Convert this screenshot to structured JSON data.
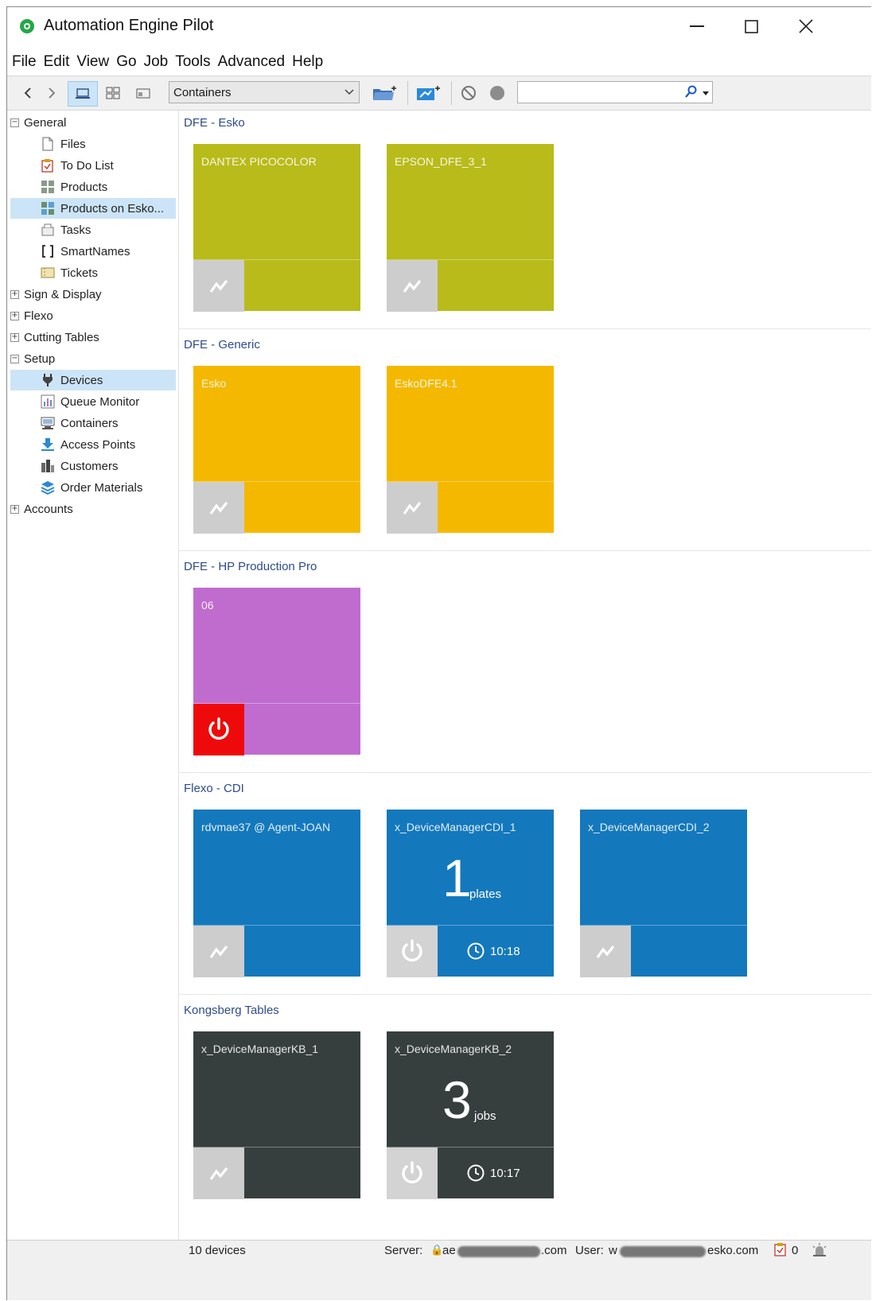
{
  "window": {
    "title": "Automation Engine Pilot",
    "minimize": "—",
    "maximize": "☐",
    "close": "✕"
  },
  "menu": [
    "File",
    "Edit",
    "View",
    "Go",
    "Job",
    "Tools",
    "Advanced",
    "Help"
  ],
  "toolbar": {
    "view_select": "Containers",
    "search_placeholder": ""
  },
  "sidebar": {
    "items": [
      {
        "label": "General",
        "level": 0,
        "expander": "−",
        "icon": ""
      },
      {
        "label": "Files",
        "level": 1,
        "expander": "",
        "icon": "file-icon"
      },
      {
        "label": "To Do List",
        "level": 1,
        "expander": "",
        "icon": "todo-icon"
      },
      {
        "label": "Products",
        "level": 1,
        "expander": "",
        "icon": "products-icon"
      },
      {
        "label": "Products on Esko...",
        "level": 1,
        "expander": "",
        "icon": "products-esko-icon"
      },
      {
        "label": "Tasks",
        "level": 1,
        "expander": "",
        "icon": "tasks-icon"
      },
      {
        "label": "SmartNames",
        "level": 1,
        "expander": "",
        "icon": "smartnames-icon"
      },
      {
        "label": "Tickets",
        "level": 1,
        "expander": "",
        "icon": "tickets-icon"
      },
      {
        "label": "Sign & Display",
        "level": 0,
        "expander": "+",
        "icon": ""
      },
      {
        "label": "Flexo",
        "level": 0,
        "expander": "+",
        "icon": ""
      },
      {
        "label": "Cutting Tables",
        "level": 0,
        "expander": "+",
        "icon": ""
      },
      {
        "label": "Setup",
        "level": 0,
        "expander": "−",
        "icon": ""
      },
      {
        "label": "Devices",
        "level": 1,
        "expander": "",
        "icon": "devices-icon"
      },
      {
        "label": "Queue Monitor",
        "level": 1,
        "expander": "",
        "icon": "queue-monitor-icon"
      },
      {
        "label": "Containers",
        "level": 1,
        "expander": "",
        "icon": "containers-icon"
      },
      {
        "label": "Access Points",
        "level": 1,
        "expander": "",
        "icon": "access-points-icon"
      },
      {
        "label": "Customers",
        "level": 1,
        "expander": "",
        "icon": "customers-icon"
      },
      {
        "label": "Order Materials",
        "level": 1,
        "expander": "",
        "icon": "order-materials-icon"
      },
      {
        "label": "Accounts",
        "level": 0,
        "expander": "+",
        "icon": ""
      }
    ]
  },
  "groups": [
    {
      "title": "DFE - Esko",
      "devices": [
        {
          "name": "DANTEX PICOCOLOR",
          "color": "#b8bb1a",
          "action": "activity"
        },
        {
          "name": "EPSON_DFE_3_1",
          "color": "#b8bb1a",
          "action": "activity"
        }
      ]
    },
    {
      "title": "DFE - Generic",
      "devices": [
        {
          "name": "Esko",
          "color": "#f5b800",
          "action": "activity"
        },
        {
          "name": "EskoDFE4.1",
          "color": "#f5b800",
          "action": "activity"
        }
      ]
    },
    {
      "title": "DFE - HP Production Pro",
      "devices": [
        {
          "name": "06",
          "color": "#c06ccf",
          "action": "power-off"
        }
      ]
    },
    {
      "title": "Flexo - CDI",
      "devices": [
        {
          "name": "rdvmae37 @ Agent-JOAN",
          "color": "#1478bd",
          "action": "activity"
        },
        {
          "name": "x_DeviceManagerCDI_1",
          "color": "#1478bd",
          "action": "power",
          "count": "1",
          "unit": "plates",
          "time": "10:18"
        },
        {
          "name": "x_DeviceManagerCDI_2",
          "color": "#1478bd",
          "action": "activity"
        }
      ]
    },
    {
      "title": "Kongsberg Tables",
      "devices": [
        {
          "name": "x_DeviceManagerKB_1",
          "color": "#373e3e",
          "action": "activity"
        },
        {
          "name": "x_DeviceManagerKB_2",
          "color": "#373e3e",
          "action": "power",
          "count": "3",
          "unit": "jobs",
          "time": "10:17"
        }
      ]
    }
  ],
  "status": {
    "device_count": "10 devices",
    "server_label": "Server:",
    "server_value_prefix": "ae",
    "server_value_suffix": ".com",
    "user_label": "User:",
    "user_value_prefix": "w",
    "user_value_suffix": "esko.com",
    "todo_count": "0"
  }
}
